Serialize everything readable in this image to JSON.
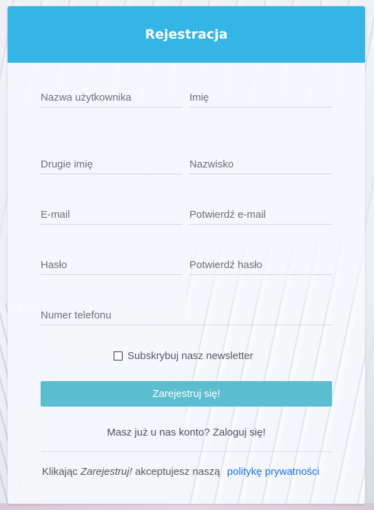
{
  "header": {
    "title": "Rejestracja"
  },
  "form": {
    "username": {
      "placeholder": "Nazwa użytkownika",
      "value": ""
    },
    "first_name": {
      "placeholder": "Imię",
      "value": ""
    },
    "middle_name": {
      "placeholder": "Drugie imię",
      "value": ""
    },
    "last_name": {
      "placeholder": "Nazwisko",
      "value": ""
    },
    "email": {
      "placeholder": "E-mail",
      "value": ""
    },
    "email_confirm": {
      "placeholder": "Potwierdź e-mail",
      "value": ""
    },
    "password": {
      "placeholder": "Hasło",
      "value": ""
    },
    "password_confirm": {
      "placeholder": "Potwierdź hasło",
      "value": ""
    },
    "phone": {
      "placeholder": "Numer telefonu",
      "value": ""
    },
    "newsletter": {
      "label": "Subskrybuj nasz newsletter",
      "checked": false
    },
    "submit_label": "Zarejestruj się!"
  },
  "login": {
    "text": "Masz już u nas konto?",
    "link": "Zaloguj się!"
  },
  "terms": {
    "prefix": "Klikając",
    "action": "Zarejestruj!",
    "middle": "akceptujesz naszą",
    "link": "politykę prywatności"
  },
  "colors": {
    "header": "#33b5e5",
    "button": "#5bbdd0",
    "link": "#1a73e8"
  },
  "icons": {
    "newsletter_checkbox": "checkbox-unchecked-icon"
  }
}
